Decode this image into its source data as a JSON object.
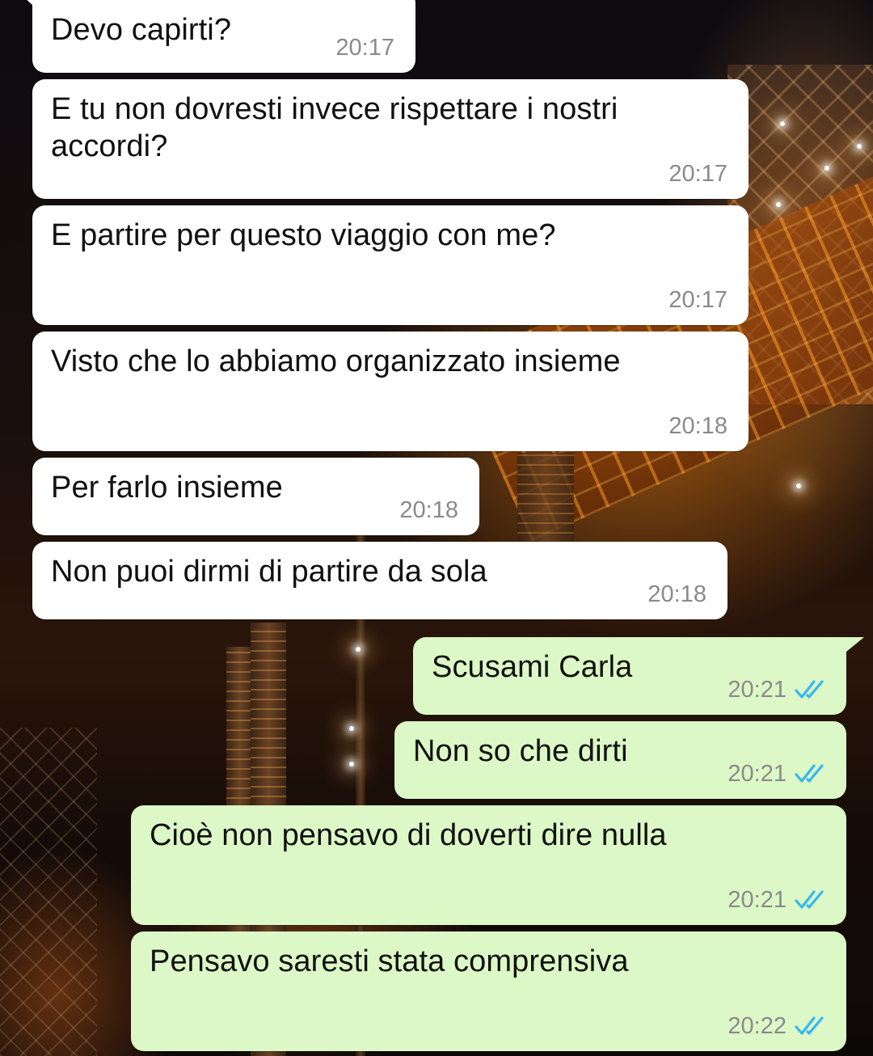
{
  "colors": {
    "incoming_bubble": "#ffffff",
    "outgoing_bubble": "#dcf8c6",
    "timestamp": "#8a8a8a",
    "read_ticks": "#34b7f1"
  },
  "messages": [
    {
      "direction": "incoming",
      "text": "Devo capirti?",
      "time": "20:17"
    },
    {
      "direction": "incoming",
      "text": "E tu non dovresti invece rispettare i nostri\naccordi?",
      "time": "20:17"
    },
    {
      "direction": "incoming",
      "text": "E partire per questo viaggio con me?",
      "time": "20:17"
    },
    {
      "direction": "incoming",
      "text": "Visto che lo abbiamo organizzato insieme",
      "time": "20:18"
    },
    {
      "direction": "incoming",
      "text": "Per farlo insieme",
      "time": "20:18"
    },
    {
      "direction": "incoming",
      "text": "Non puoi dirmi di partire da sola",
      "time": "20:18"
    },
    {
      "direction": "outgoing",
      "text": "Scusami Carla",
      "time": "20:21",
      "status_icon": "double-check-read-icon"
    },
    {
      "direction": "outgoing",
      "text": "Non so che dirti",
      "time": "20:21",
      "status_icon": "double-check-read-icon"
    },
    {
      "direction": "outgoing",
      "text": "Cioè non pensavo di doverti dire nulla",
      "time": "20:21",
      "status_icon": "double-check-read-icon"
    },
    {
      "direction": "outgoing",
      "text": "Pensavo saresti stata comprensiva",
      "time": "20:22",
      "status_icon": "double-check-read-icon"
    }
  ]
}
